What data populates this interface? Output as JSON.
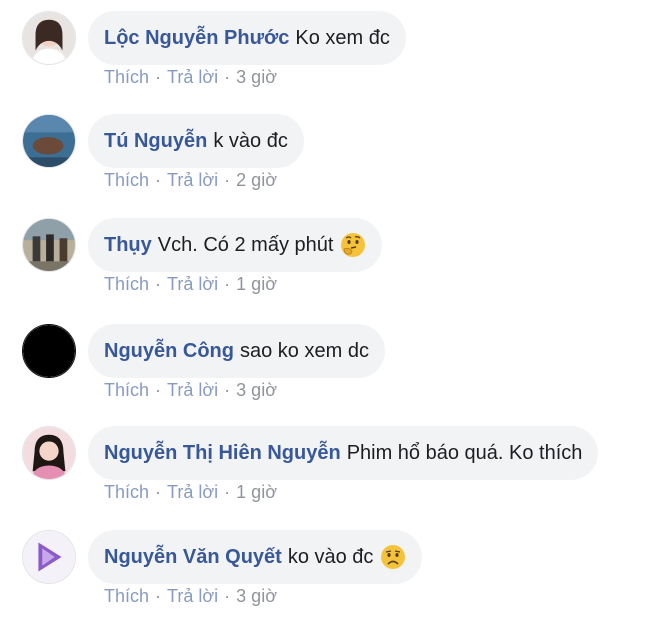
{
  "labels": {
    "like": "Thích",
    "reply": "Trả lời",
    "sep": "·"
  },
  "comments": [
    {
      "author": "Lộc Nguyễn Phước",
      "text": "Ko xem đc",
      "time": "3 giờ",
      "emoji": ""
    },
    {
      "author": "Tú Nguyễn",
      "text": "k vào đc",
      "time": "2 giờ",
      "emoji": ""
    },
    {
      "author": "Thụy",
      "text": "Vch. Có 2 mấy phút",
      "time": "1 giờ",
      "emoji": "thinking-face-icon"
    },
    {
      "author": "Nguyễn Công",
      "text": "sao ko xem dc",
      "time": "3 giờ",
      "emoji": ""
    },
    {
      "author": "Nguyễn Thị Hiên Nguyễn",
      "text": "Phim hổ báo quá. Ko thích",
      "time": "1 giờ",
      "emoji": ""
    },
    {
      "author": "Nguyễn Văn Quyết",
      "text": "ko vào đc",
      "time": "3 giờ",
      "emoji": "disappointed-face-icon"
    }
  ],
  "colors": {
    "author": "#385898",
    "bubble": "#f2f3f5",
    "meta": "#90949c",
    "emoji": "#f5c33b"
  }
}
